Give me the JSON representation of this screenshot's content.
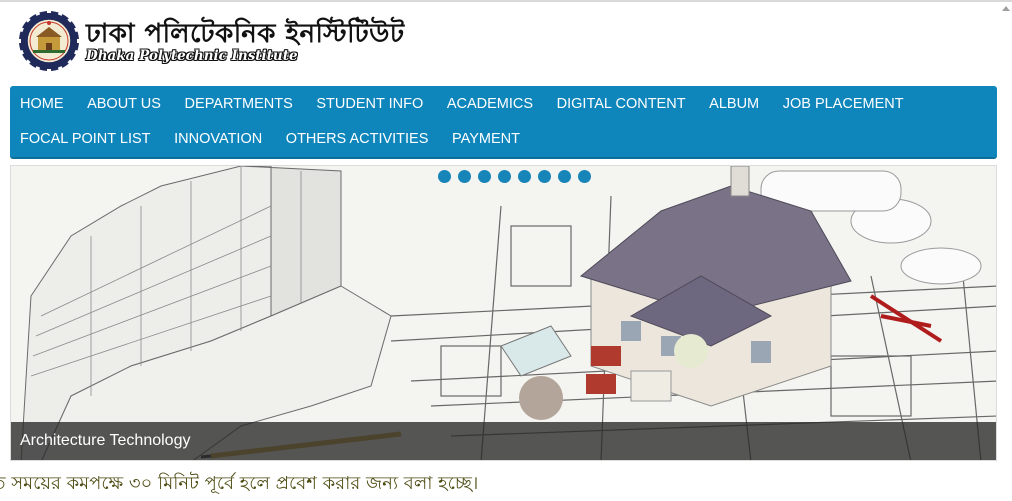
{
  "header": {
    "title_bn": "ঢাকা পলিটেকনিক ইনস্টিটিউট",
    "title_en": "Dhaka Polytechnic Institute",
    "logo_icon": "institute-emblem"
  },
  "nav": {
    "row1": [
      "HOME",
      "ABOUT US",
      "DEPARTMENTS",
      "STUDENT INFO",
      "ACADEMICS",
      "DIGITAL CONTENT",
      "ALBUM",
      "JOB PLACEMENT"
    ],
    "row2": [
      "FOCAL POINT LIST",
      "INNOVATION",
      "OTHERS ACTIVITIES",
      "PAYMENT"
    ]
  },
  "slider": {
    "dot_count": 8,
    "caption": "Architecture Technology"
  },
  "notice": {
    "marquee_text": "ত সময়ের কমপক্ষে ৩০ মিনিট পূর্বে হলে প্রবেশ করার জন্য বলা হচ্ছে।"
  },
  "colors": {
    "nav_bg": "#0e86bc",
    "dot": "#1785b8",
    "marquee_text": "#4d4b12"
  }
}
